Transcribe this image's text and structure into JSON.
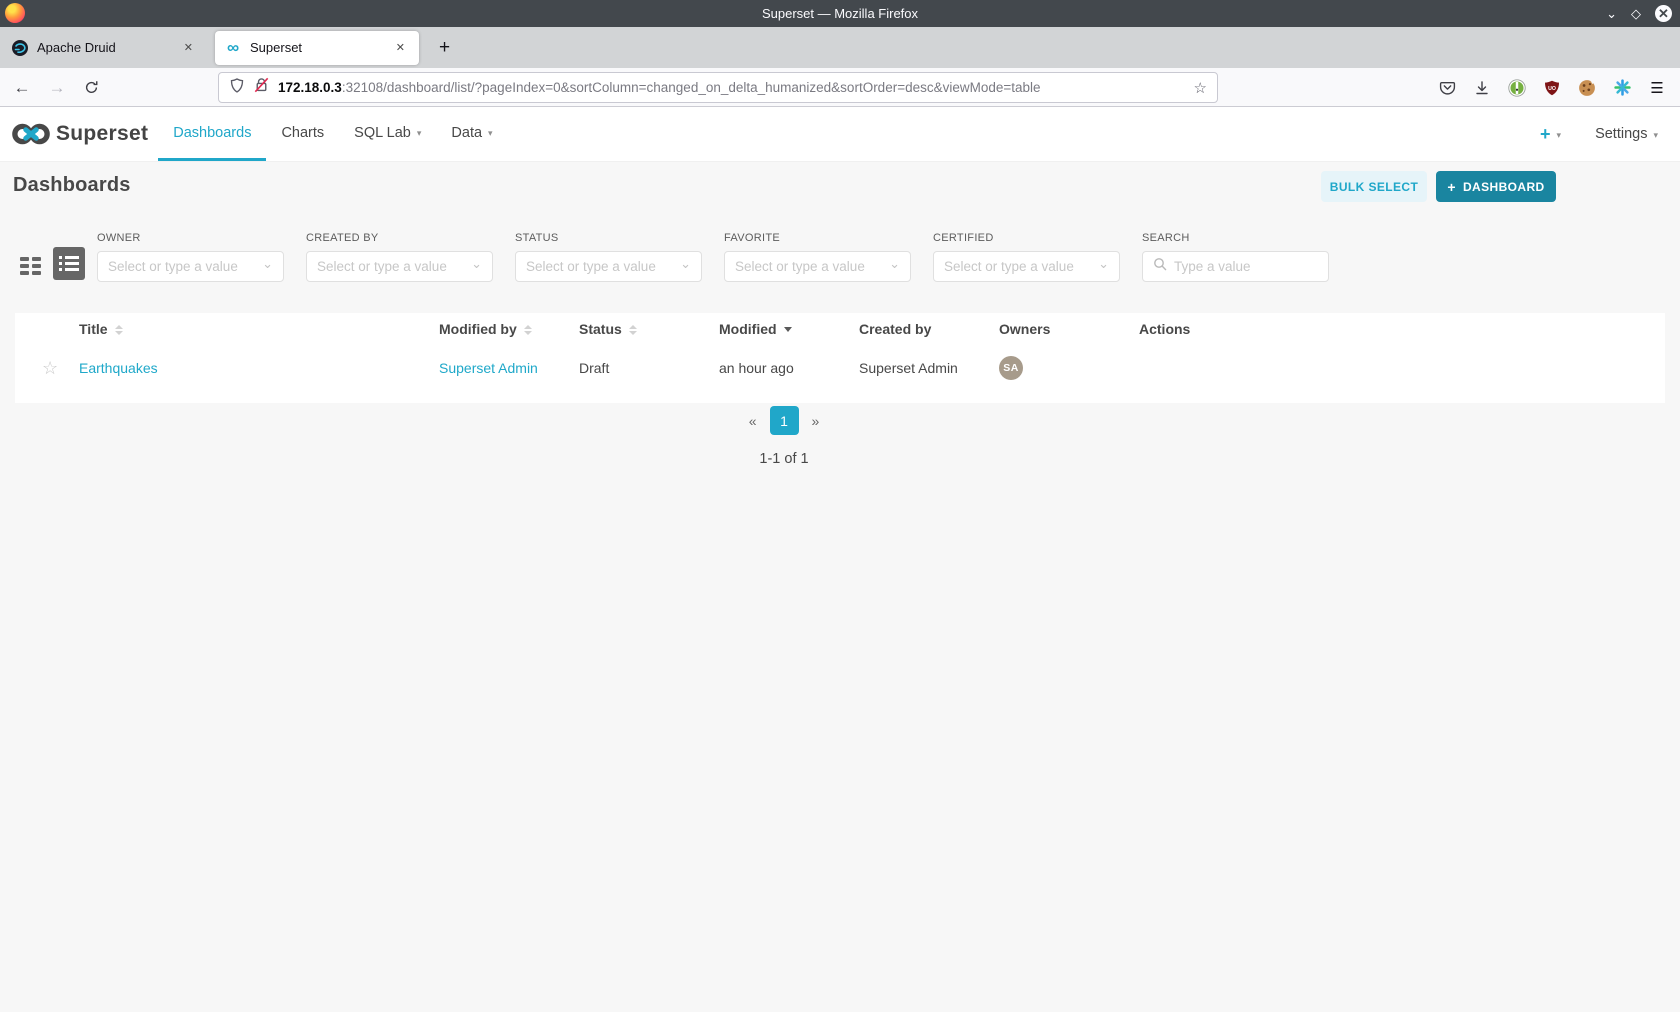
{
  "browser": {
    "window_title": "Superset — Mozilla Firefox",
    "tabs": [
      {
        "title": "Apache Druid"
      },
      {
        "title": "Superset"
      }
    ],
    "url": {
      "host": "172.18.0.3",
      "rest": ":32108/dashboard/list/?pageIndex=0&sortColumn=changed_on_delta_humanized&sortOrder=desc&viewMode=table"
    }
  },
  "icons": {
    "minimize": "⌄",
    "maximize": "◇",
    "close": "✕",
    "tab_close": "✕",
    "new_tab": "+",
    "back": "←",
    "forward": "→",
    "bookmark_star": "☆",
    "menu": "☰",
    "caret_down": "▾",
    "chevron_down": "⌄",
    "plus": "+",
    "favorite_star": "☆",
    "superset_favicon": "∞",
    "prev": "«",
    "next": "»"
  },
  "app": {
    "brand": "Superset",
    "nav": {
      "items": [
        {
          "label": "Dashboards"
        },
        {
          "label": "Charts"
        },
        {
          "label": "SQL Lab"
        },
        {
          "label": "Data"
        }
      ],
      "settings": "Settings"
    },
    "header": {
      "title": "Dashboards",
      "bulk_select": "BULK SELECT",
      "new_dashboard": "DASHBOARD"
    },
    "filters": [
      {
        "label": "OWNER",
        "placeholder": "Select or type a value"
      },
      {
        "label": "CREATED BY",
        "placeholder": "Select or type a value"
      },
      {
        "label": "STATUS",
        "placeholder": "Select or type a value"
      },
      {
        "label": "FAVORITE",
        "placeholder": "Select or type a value"
      },
      {
        "label": "CERTIFIED",
        "placeholder": "Select or type a value"
      },
      {
        "label": "SEARCH",
        "placeholder": "Type a value"
      }
    ],
    "table": {
      "columns": {
        "title": "Title",
        "modified_by": "Modified by",
        "status": "Status",
        "modified": "Modified",
        "created_by": "Created by",
        "owners": "Owners",
        "actions": "Actions"
      },
      "rows": [
        {
          "title": "Earthquakes",
          "modified_by": "Superset Admin",
          "status": "Draft",
          "modified": "an hour ago",
          "created_by": "Superset Admin",
          "owner_initials": "SA"
        }
      ]
    },
    "pagination": {
      "current": "1",
      "summary": "1-1 of 1"
    }
  },
  "colors": {
    "primary": "#20a7c9",
    "primary_dark": "#1a85a0",
    "link": "#1fa8c9",
    "avatar_bg": "#a79b8b",
    "page_bg": "#f7f7f7"
  }
}
